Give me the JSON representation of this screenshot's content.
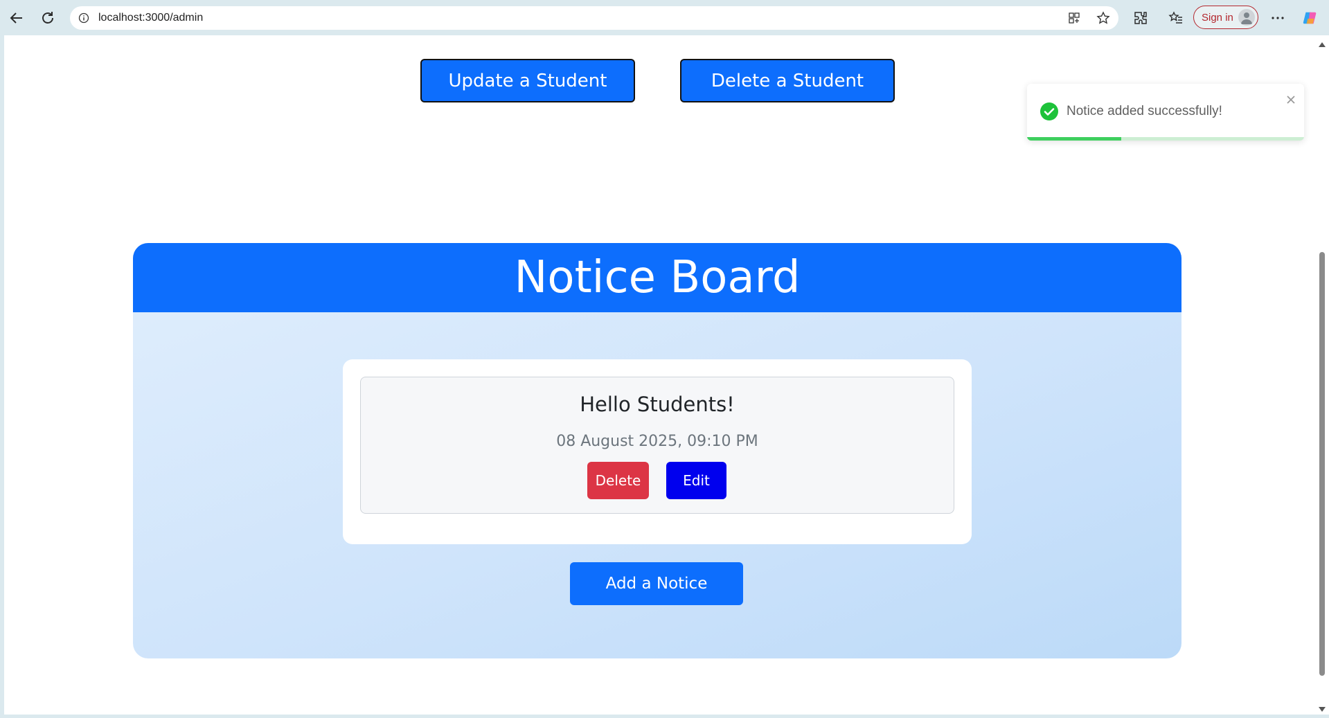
{
  "browser": {
    "url": "localhost:3000/admin",
    "sign_in_label": "Sign in"
  },
  "top_actions": {
    "update_label": "Update a Student",
    "delete_label": "Delete a Student"
  },
  "notice_board": {
    "title": "Notice Board",
    "notices": [
      {
        "title": "Hello Students!",
        "date": "08 August 2025, 09:10 PM",
        "delete_label": "Delete",
        "edit_label": "Edit"
      }
    ],
    "add_label": "Add a Notice"
  },
  "toast": {
    "message": "Notice added successfully!",
    "progress": 0.34
  },
  "colors": {
    "primary": "#0d6efd",
    "danger": "#dc3545",
    "edit": "#0000ee",
    "success": "#1ec23a"
  }
}
